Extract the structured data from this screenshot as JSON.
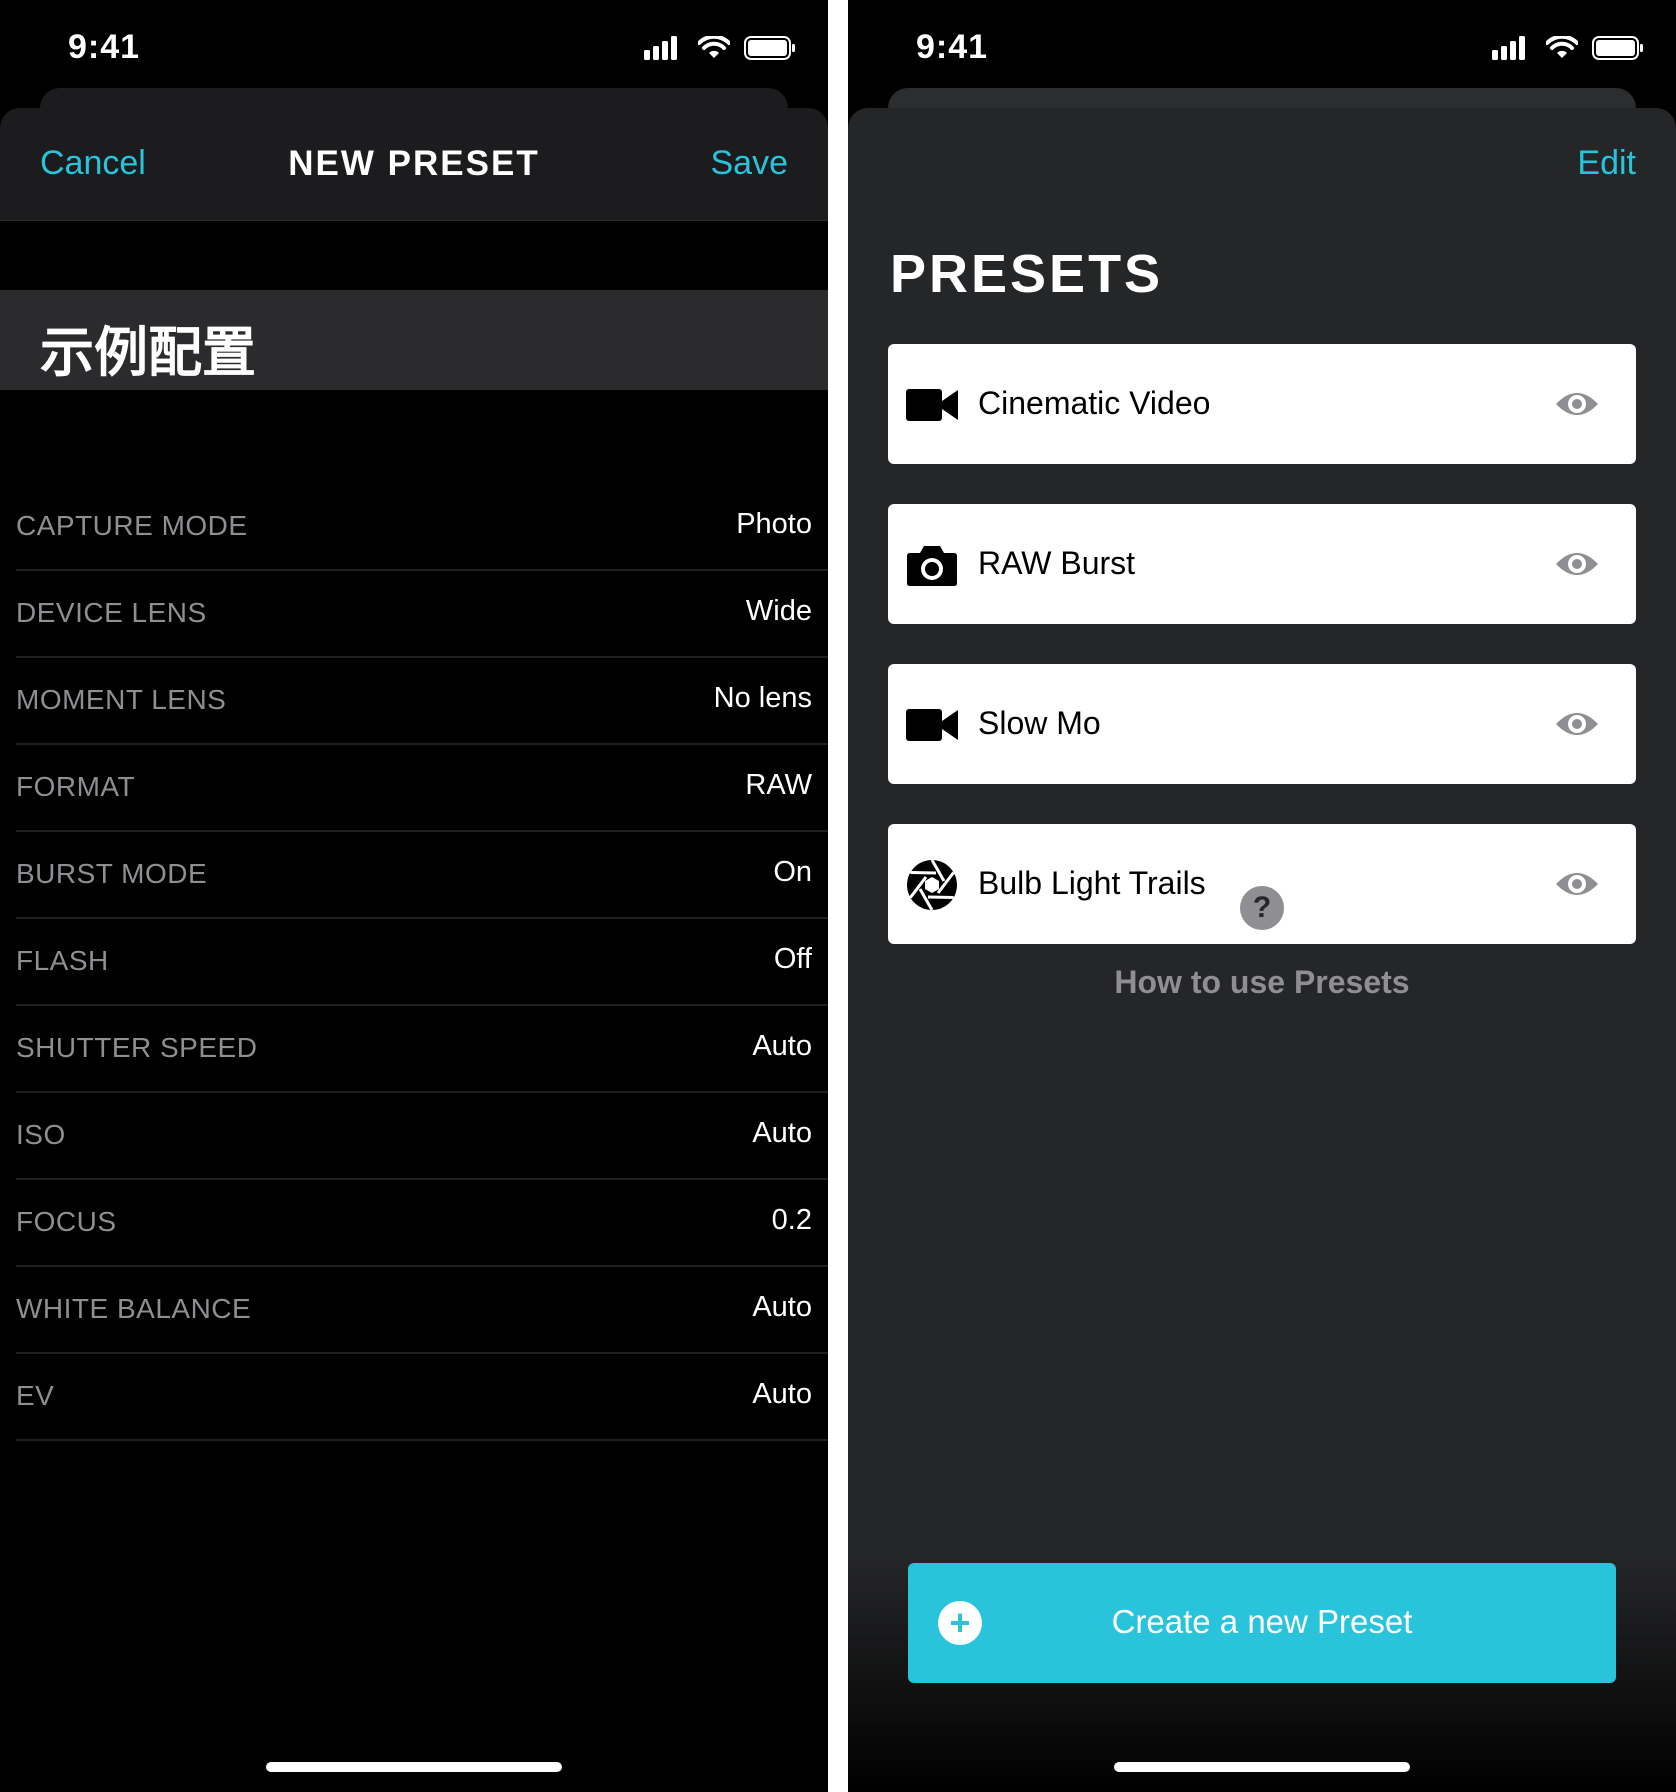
{
  "left_screen": {
    "status": {
      "time": "9:41"
    },
    "nav": {
      "cancel_label": "Cancel",
      "title": "NEW PRESET",
      "save_label": "Save"
    },
    "preset_name": "示例配置",
    "settings": [
      {
        "label": "CAPTURE MODE",
        "value": "Photo"
      },
      {
        "label": "DEVICE LENS",
        "value": "Wide"
      },
      {
        "label": "MOMENT LENS",
        "value": "No lens"
      },
      {
        "label": "FORMAT",
        "value": "RAW"
      },
      {
        "label": "BURST MODE",
        "value": "On"
      },
      {
        "label": "FLASH",
        "value": "Off"
      },
      {
        "label": "SHUTTER SPEED",
        "value": "Auto"
      },
      {
        "label": "ISO",
        "value": "Auto"
      },
      {
        "label": "FOCUS",
        "value": "0.2"
      },
      {
        "label": "WHITE BALANCE",
        "value": "Auto"
      },
      {
        "label": "EV",
        "value": "Auto"
      }
    ]
  },
  "right_screen": {
    "status": {
      "time": "9:41"
    },
    "edit_label": "Edit",
    "title": "PRESETS",
    "presets": [
      {
        "name": "Cinematic Video",
        "icon": "video-camera-icon"
      },
      {
        "name": "RAW Burst",
        "icon": "camera-icon"
      },
      {
        "name": "Slow Mo",
        "icon": "video-camera-icon"
      },
      {
        "name": "Bulb Light Trails",
        "icon": "aperture-icon"
      }
    ],
    "help_label": "How to use Presets",
    "create_label": "Create a new Preset"
  },
  "colors": {
    "accent": "#29c3db",
    "sheet_dark": "#252628",
    "nav_dark": "#1c1c1e"
  }
}
